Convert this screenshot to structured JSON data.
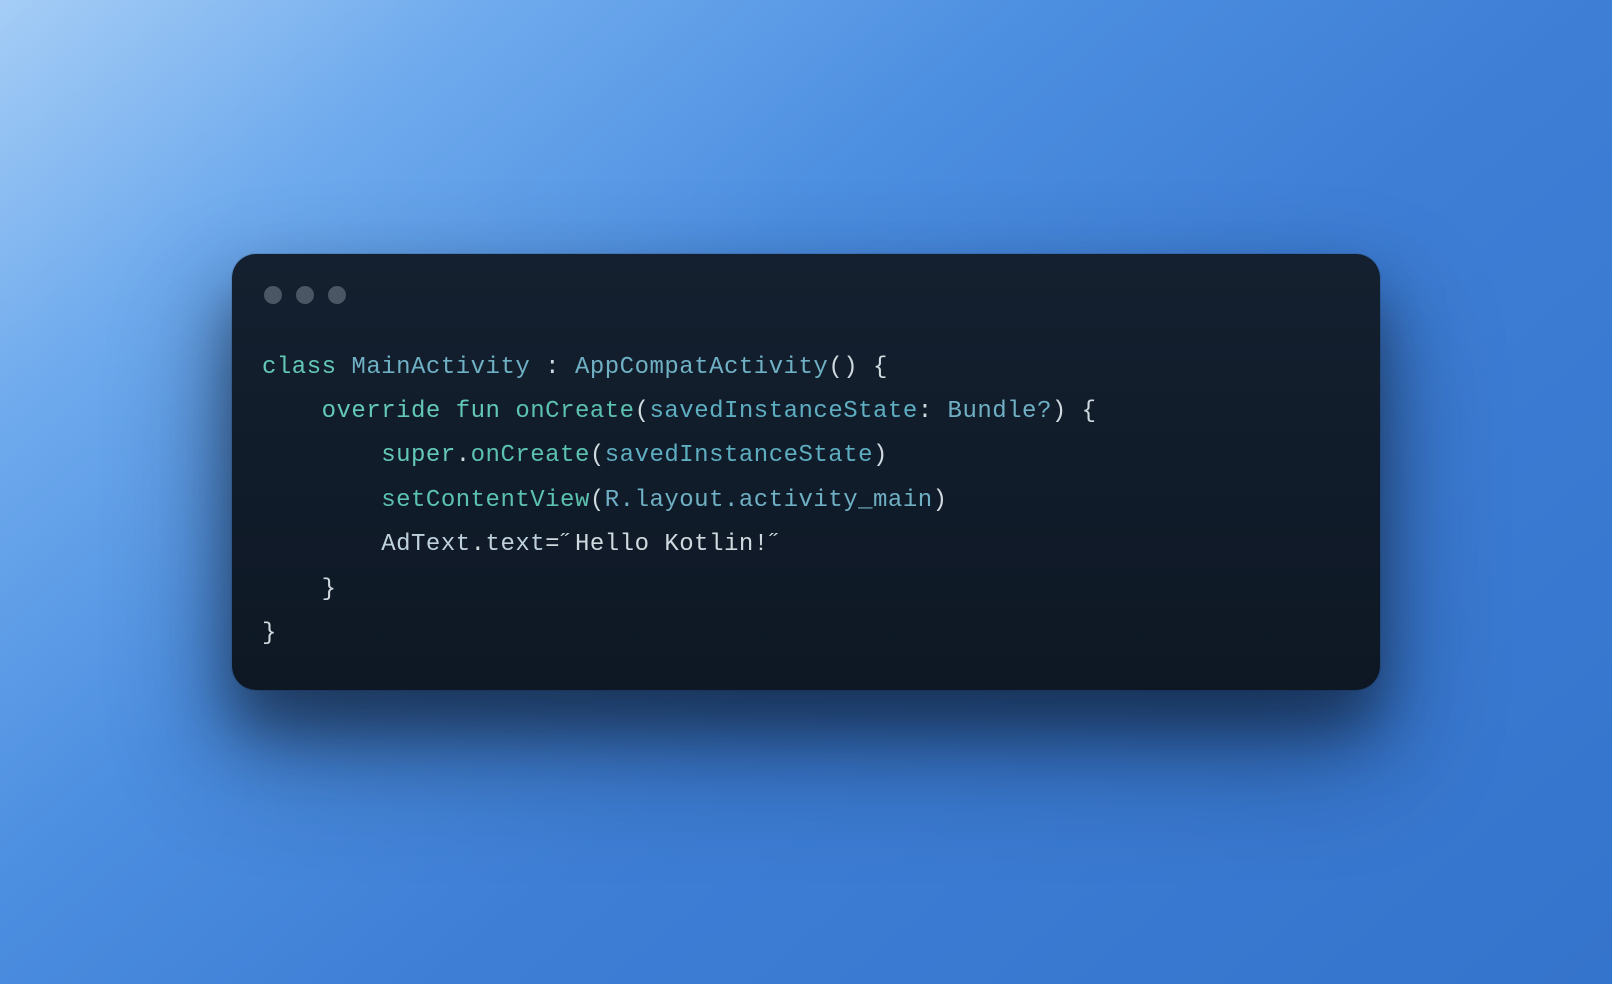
{
  "code": {
    "tokens": {
      "kw_class": "class",
      "className": "MainActivity",
      "colon": " : ",
      "superType": "AppCompatActivity",
      "parens_empty": "()",
      "brace_open": " {",
      "indent1": "    ",
      "kw_override": "override",
      "space": " ",
      "kw_fun": "fun",
      "fn_onCreate": "onCreate",
      "paren_open": "(",
      "param_name": "savedInstanceState",
      "param_colon": ": ",
      "param_type": "Bundle?",
      "paren_close": ")",
      "indent2": "        ",
      "kw_super": "super",
      "dot": ".",
      "call_onCreate": "onCreate",
      "arg_sis": "savedInstanceState",
      "fn_setContentView": "setContentView",
      "r_path": "R.layout.activity_main",
      "adtext": "AdText",
      "prop_text": "text",
      "equals": "=",
      "str_hello": "˝Hello Kotlin!˝",
      "brace_close_inner": "}",
      "brace_close_outer": "}"
    }
  }
}
